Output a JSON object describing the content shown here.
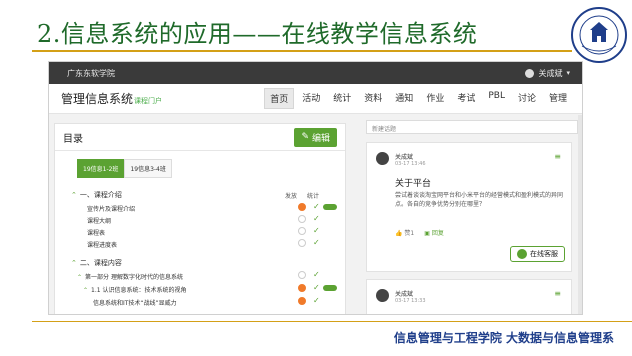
{
  "slide": {
    "title": "2.信息系统的应用——在线教学信息系统",
    "footer": "信息管理与工程学院  大数据与信息管理系"
  },
  "app": {
    "school_name": "广东东软学院",
    "user_name": "关成斌",
    "brand": "管理信息系统",
    "brand_sub": "课程门户",
    "menu": [
      "首页",
      "活动",
      "统计",
      "资料",
      "通知",
      "作业",
      "考试",
      "PBL",
      "讨论",
      "管理"
    ],
    "active_menu": "首页"
  },
  "catalog": {
    "title": "目录",
    "edit_label": "编辑",
    "tabs": [
      "19信息1-2班",
      "19信息3-4班"
    ],
    "col_publish": "发放",
    "col_stats": "统计",
    "rows": [
      {
        "text": "一、课程介绍",
        "kind": "section"
      },
      {
        "text": "宣传片及课程介绍",
        "kind": "item",
        "status": "orange",
        "pill": true
      },
      {
        "text": "课程大纲",
        "kind": "item",
        "status": "empty",
        "pill": false
      },
      {
        "text": "课程表",
        "kind": "item",
        "status": "empty",
        "pill": false
      },
      {
        "text": "课程进度表",
        "kind": "item",
        "status": "empty",
        "pill": false
      },
      {
        "text": "二、课程内容",
        "kind": "section"
      },
      {
        "text": "第一部分 理解数字化时代的信息系统",
        "kind": "part",
        "status": "empty",
        "pill": false
      },
      {
        "text": "1.1 认识信息系统：技术系统的视角",
        "kind": "sub",
        "status": "orange",
        "pill": true
      },
      {
        "text": "信息系统和IT技术“战线”显威力",
        "kind": "leaf",
        "status": "orange",
        "pill": false
      }
    ]
  },
  "discussion": {
    "new_topic_placeholder": "新建话题",
    "card1": {
      "author": "关成斌",
      "time": "03-17 13:46",
      "title": "关于平台",
      "body": "尝试着谈谈淘宝网平台和小米平台的经营模式和盈利模式的异同点。各自的竞争优势分别在哪里？",
      "likes": "赞1",
      "comments": "回复"
    },
    "online_service": "在线客服",
    "card2": {
      "author": "关成斌",
      "time": "03-17 13:33"
    }
  },
  "colors": {
    "title_green": "#1f6a2a",
    "accent_green": "#5ba232",
    "gold_rule": "#d4a017",
    "footer_blue": "#1f3e8a",
    "status_orange": "#f07a2a"
  }
}
